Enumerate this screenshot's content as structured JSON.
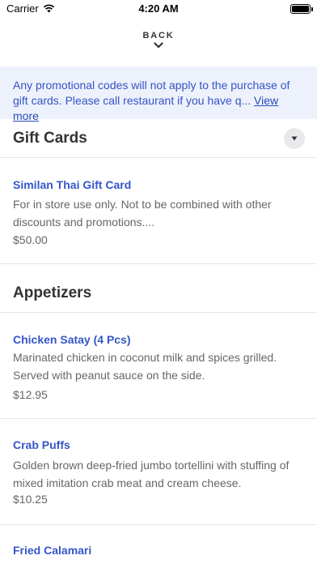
{
  "status_bar": {
    "carrier": "Carrier",
    "time": "4:20 AM",
    "icons": [
      "wifi-icon",
      "battery-icon"
    ]
  },
  "nav": {
    "back_label": "BACK",
    "back_icon": "chevron-down-icon"
  },
  "banner": {
    "text": "Any promotional codes will not apply to the purchase of gift cards. Please call restaurant if you have q...",
    "link": "View more"
  },
  "sections": [
    {
      "title": "Gift Cards",
      "toggle_icon": "triangle-down-icon",
      "items": [
        {
          "name": "Similan Thai Gift Card",
          "description": "For in store use only.  Not to be combined with other discounts and promotions....",
          "price": "$50.00"
        }
      ]
    },
    {
      "title": "Appetizers",
      "items": [
        {
          "name": "Chicken Satay (4 Pcs)",
          "description": "Marinated chicken in coconut milk and spices grilled. Served with peanut sauce on the side.",
          "price": "$12.95"
        },
        {
          "name": "Crab Puffs",
          "description": "Golden brown deep-fried jumbo tortellini with stuffing of mixed imitation crab meat and cream cheese.",
          "price": "$10.25"
        },
        {
          "name": "Fried Calamari"
        }
      ]
    }
  ],
  "colors": {
    "accent": "#3556c8",
    "banner_bg": "#edf1fc",
    "banner_text": "#3554c4",
    "divider": "#e6e6e6"
  }
}
